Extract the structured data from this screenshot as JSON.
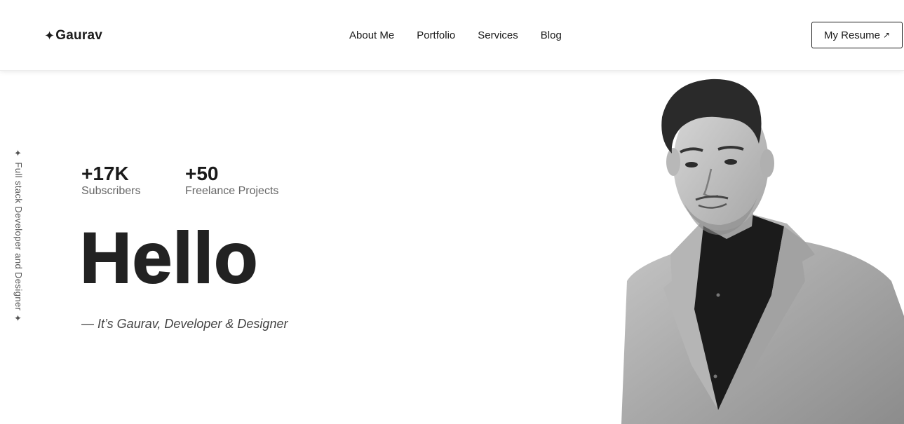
{
  "header": {
    "logo_star": "✦",
    "logo_text": "Gaurav",
    "nav": [
      "About Me",
      "Portfolio",
      "Services",
      "Blog"
    ],
    "resume_label": "My Resume",
    "resume_icon": "arrow-up-right-icon",
    "resume_arrow": "↗"
  },
  "side_text": "✦ Full stack Developer and Designer ✦",
  "stats": [
    {
      "value": "+17K",
      "label": "Subscribers"
    },
    {
      "value": "+50",
      "label": "Freelance Projects"
    }
  ],
  "hero": {
    "headline": "Hello",
    "tagline": "— It’s Gaurav, Developer & Designer"
  },
  "colors": {
    "text": "#1a1a1a",
    "muted": "#666666",
    "background": "#ffffff"
  }
}
